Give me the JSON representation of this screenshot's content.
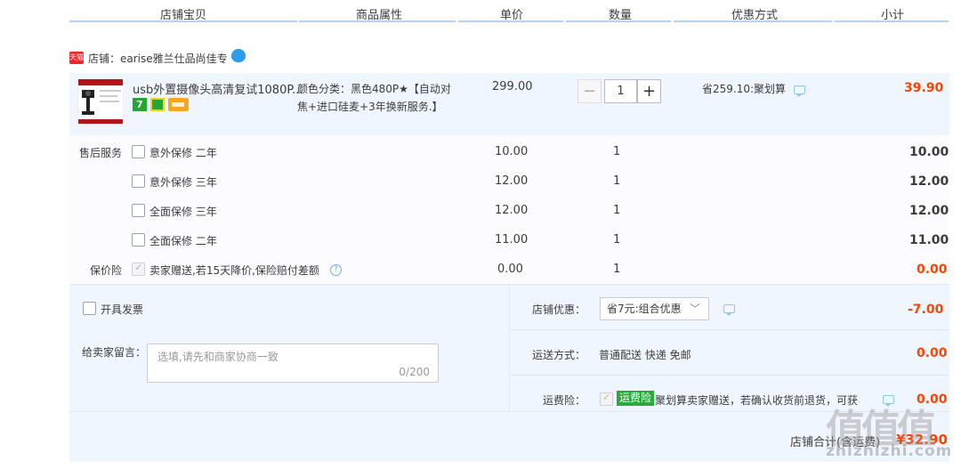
{
  "header": {
    "columns": [
      "店铺宝贝",
      "商品属性",
      "单价",
      "数量",
      "优惠方式",
      "小计"
    ]
  },
  "shop": {
    "badge": "天猫",
    "label": "店铺：earise雅兰仕品尚佳专"
  },
  "item": {
    "title": "usb外置摄像头高清复试1080P...",
    "attr_line1": "颜色分类：黑色480P★【自动对",
    "attr_line2": "焦+进口硅麦+3年换新服务.】",
    "price": "299.00",
    "quantity": "1",
    "qty_minus": "−",
    "qty_plus": "+",
    "promo": "省259.10:聚划算",
    "subtotal": "39.90",
    "badge_seven": "7"
  },
  "services": {
    "section_label": "售后服务",
    "rows": [
      {
        "label": "意外保修 二年",
        "price": "10.00",
        "qty": "1",
        "subtotal": "10.00"
      },
      {
        "label": "意外保修 三年",
        "price": "12.00",
        "qty": "1",
        "subtotal": "12.00"
      },
      {
        "label": "全面保修 三年",
        "price": "12.00",
        "qty": "1",
        "subtotal": "12.00"
      },
      {
        "label": "全面保修 二年",
        "price": "11.00",
        "qty": "1",
        "subtotal": "11.00"
      }
    ]
  },
  "price_protection": {
    "section_label": "保价险",
    "label": "卖家赠送,若15天降价,保险赔付差额",
    "price": "0.00",
    "qty": "1",
    "subtotal": "0.00"
  },
  "invoice": {
    "label": "开具发票"
  },
  "message": {
    "label": "给卖家留言：",
    "placeholder": "选填,请先和商家协商一致",
    "counter": "0/200"
  },
  "shop_discount": {
    "label": "店铺优惠：",
    "selected": "省7元:组合优惠",
    "amount": "-7.00"
  },
  "shipping": {
    "label": "运送方式：",
    "method": "普通配送 快递 免邮",
    "amount": "0.00"
  },
  "shipping_insurance": {
    "label": "运费险：",
    "tag": "运费险",
    "text": "聚划算卖家赠送，若确认收货前退货，可获",
    "amount": "0.00"
  },
  "total": {
    "label": "店铺合计(含运费)",
    "amount": "¥32.90"
  },
  "watermark": {
    "text": "值值值",
    "url": "zhizhizhi.com"
  },
  "colors": {
    "accent": "#ff4400",
    "header_line": "#b2d1ff",
    "row_bg": "#f0f6ff",
    "tag_green": "#2aaa3c"
  }
}
